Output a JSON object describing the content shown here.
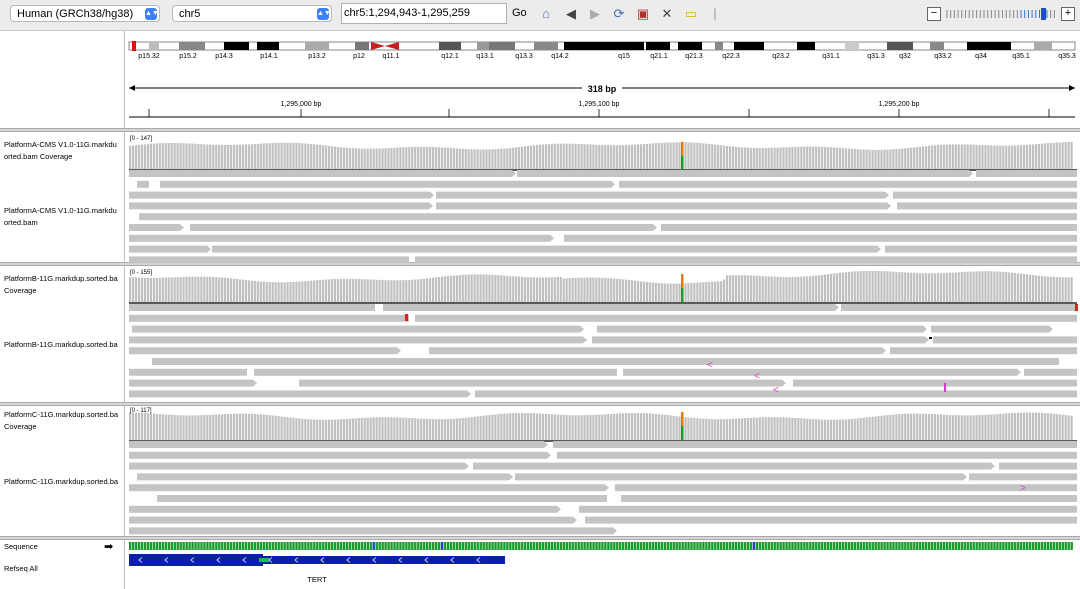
{
  "toolbar": {
    "genome": "Human (GRCh38/hg38)",
    "chromosome": "chr5",
    "locus": "chr5:1,294,943-1,295,259",
    "go_label": "Go"
  },
  "ideogram": {
    "bands": [
      "p15.32",
      "p15.2",
      "p14.3",
      "p14.1",
      "p13.2",
      "p12",
      "q11.1",
      "q12.1",
      "q13.1",
      "q13.3",
      "q14.2",
      "q15",
      "q21.1",
      "q21.3",
      "q22.3",
      "q23.2",
      "q31.1",
      "q31.3",
      "q32",
      "q33.2",
      "q34",
      "q35.1",
      "q35.3"
    ]
  },
  "ruler": {
    "span_label": "318 bp",
    "ticks": [
      "1,295,000 bp",
      "1,295,100 bp",
      "1,295,200 bp"
    ]
  },
  "tracks": {
    "a_coverage": {
      "name": "PlatformA-CMS V1.0-11G.markdu orted.bam Coverage",
      "range": "[0 - 147]"
    },
    "a_alignment": {
      "name": "PlatformA-CMS V1.0-11G.markdu orted.bam"
    },
    "b_coverage": {
      "name": "PlatformB-11G.markdup.sorted.ba Coverage",
      "range": "[0 - 155]"
    },
    "b_alignment": {
      "name": "PlatformB-11G.markdup.sorted.ba"
    },
    "c_coverage": {
      "name": "PlatformC-11G.markdup.sorted.ba Coverage",
      "range": "[0 - 117]"
    },
    "c_alignment": {
      "name": "PlatformC-11G.markdup.sorted.ba"
    },
    "sequence": {
      "name": "Sequence"
    },
    "refseq": {
      "name": "Refseq All",
      "gene": "TERT"
    }
  },
  "colors": {
    "coverage": "#c0c0c0",
    "read": "#c4c4c4",
    "gene": "#0b1fa8",
    "variant_a": "#e07b14",
    "variant_g": "#1a9c2c",
    "mismatch": "#e01e1e",
    "insertion": "#d63cc4"
  }
}
